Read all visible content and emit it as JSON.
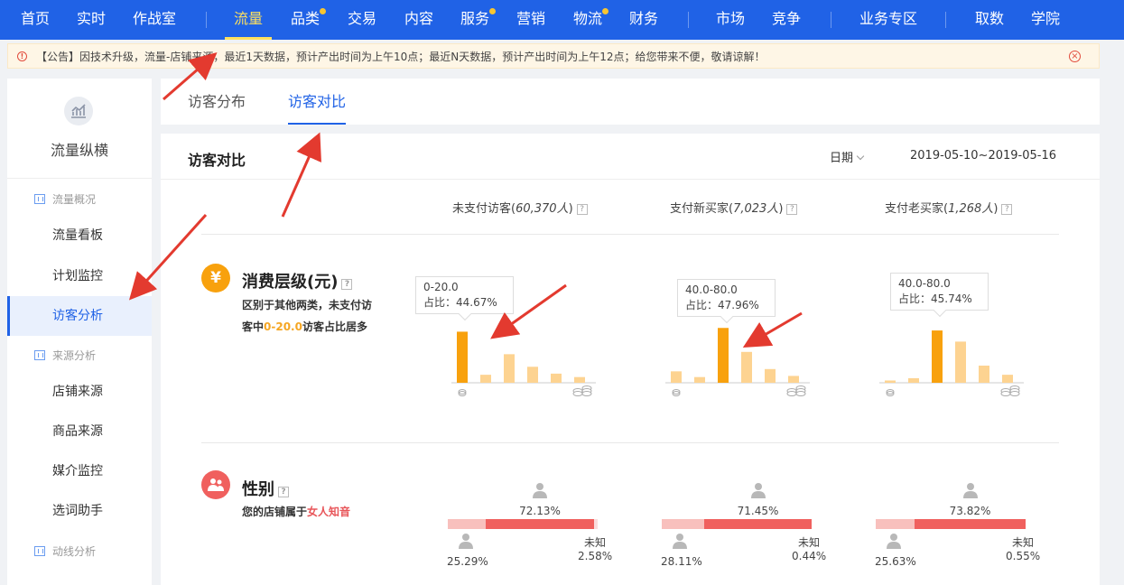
{
  "nav": {
    "items": [
      {
        "label": "首页"
      },
      {
        "label": "实时"
      },
      {
        "label": "作战室"
      },
      {
        "label": "流量"
      },
      {
        "label": "品类"
      },
      {
        "label": "交易"
      },
      {
        "label": "内容"
      },
      {
        "label": "服务"
      },
      {
        "label": "营销"
      },
      {
        "label": "物流"
      },
      {
        "label": "财务"
      },
      {
        "label": "市场"
      },
      {
        "label": "竞争"
      },
      {
        "label": "业务专区"
      },
      {
        "label": "取数"
      },
      {
        "label": "学院"
      }
    ],
    "active": "流量",
    "accent_color": "#fde05f",
    "bar_color": "#2062e6"
  },
  "notice": {
    "text": "【公告】因技术升级，流量-店铺来源，最近1天数据，预计产出时间为上午10点；最近N天数据，预计产出时间为上午12点；给您带来不便，敬请谅解！"
  },
  "sidebar": {
    "title": "流量纵横",
    "groups": [
      {
        "label": "流量概况",
        "items": [
          {
            "label": "流量看板"
          },
          {
            "label": "计划监控"
          },
          {
            "label": "访客分析"
          }
        ]
      },
      {
        "label": "来源分析",
        "items": [
          {
            "label": "店铺来源"
          },
          {
            "label": "商品来源"
          },
          {
            "label": "媒介监控"
          },
          {
            "label": "选词助手"
          }
        ]
      },
      {
        "label": "动线分析",
        "items": []
      }
    ],
    "active": "访客分析"
  },
  "tabs": [
    {
      "label": "访客分布"
    },
    {
      "label": "访客对比"
    }
  ],
  "panel": {
    "title": "访客对比",
    "date_label": "日期",
    "date_range": "2019-05-10~2019-05-16",
    "columns": [
      {
        "label": "未支付访客",
        "count": "60,370人"
      },
      {
        "label": "支付新买家",
        "count": "7,023人"
      },
      {
        "label": "支付老买家",
        "count": "1,268人"
      }
    ]
  },
  "spending": {
    "title": "消费层级(元)",
    "icon": "yen-icon",
    "desc_1": "区别于其他两类，未支付访",
    "desc_2": "客中",
    "desc_highlight": "0-20.0",
    "desc_3": "访客占比居多",
    "charts": [
      {
        "tip_range": "0-20.0",
        "tip_share": "占比：44.67%",
        "highlight": 0,
        "values": [
          44.67,
          7,
          25,
          14,
          8,
          5
        ]
      },
      {
        "tip_range": "40.0-80.0",
        "tip_share": "占比：47.96%",
        "highlight": 2,
        "values": [
          10,
          5,
          47.96,
          27,
          12,
          6
        ]
      },
      {
        "tip_range": "40.0-80.0",
        "tip_share": "占比：45.74%",
        "highlight": 2,
        "values": [
          2,
          4,
          45.74,
          36,
          15,
          7
        ]
      }
    ],
    "bar_color": "#f8a10d",
    "bar_light": "#fdd391"
  },
  "gender": {
    "title": "性别",
    "icon": "gender-icon",
    "desc_1": "您的店铺属于",
    "desc_highlight": "女人知音",
    "unknown_label": "未知",
    "groups": [
      {
        "female": "72.13%",
        "male": "25.29%",
        "unknown": "2.58%",
        "female_v": 72.13,
        "male_v": 25.29,
        "unknown_v": 2.58
      },
      {
        "female": "71.45%",
        "male": "28.11%",
        "unknown": "0.44%",
        "female_v": 71.45,
        "male_v": 28.11,
        "unknown_v": 0.44
      },
      {
        "female": "73.82%",
        "male": "25.63%",
        "unknown": "0.55%",
        "female_v": 73.82,
        "male_v": 25.63,
        "unknown_v": 0.55
      }
    ],
    "female_color": "#f0605e",
    "male_color": "#f8c0bd"
  }
}
